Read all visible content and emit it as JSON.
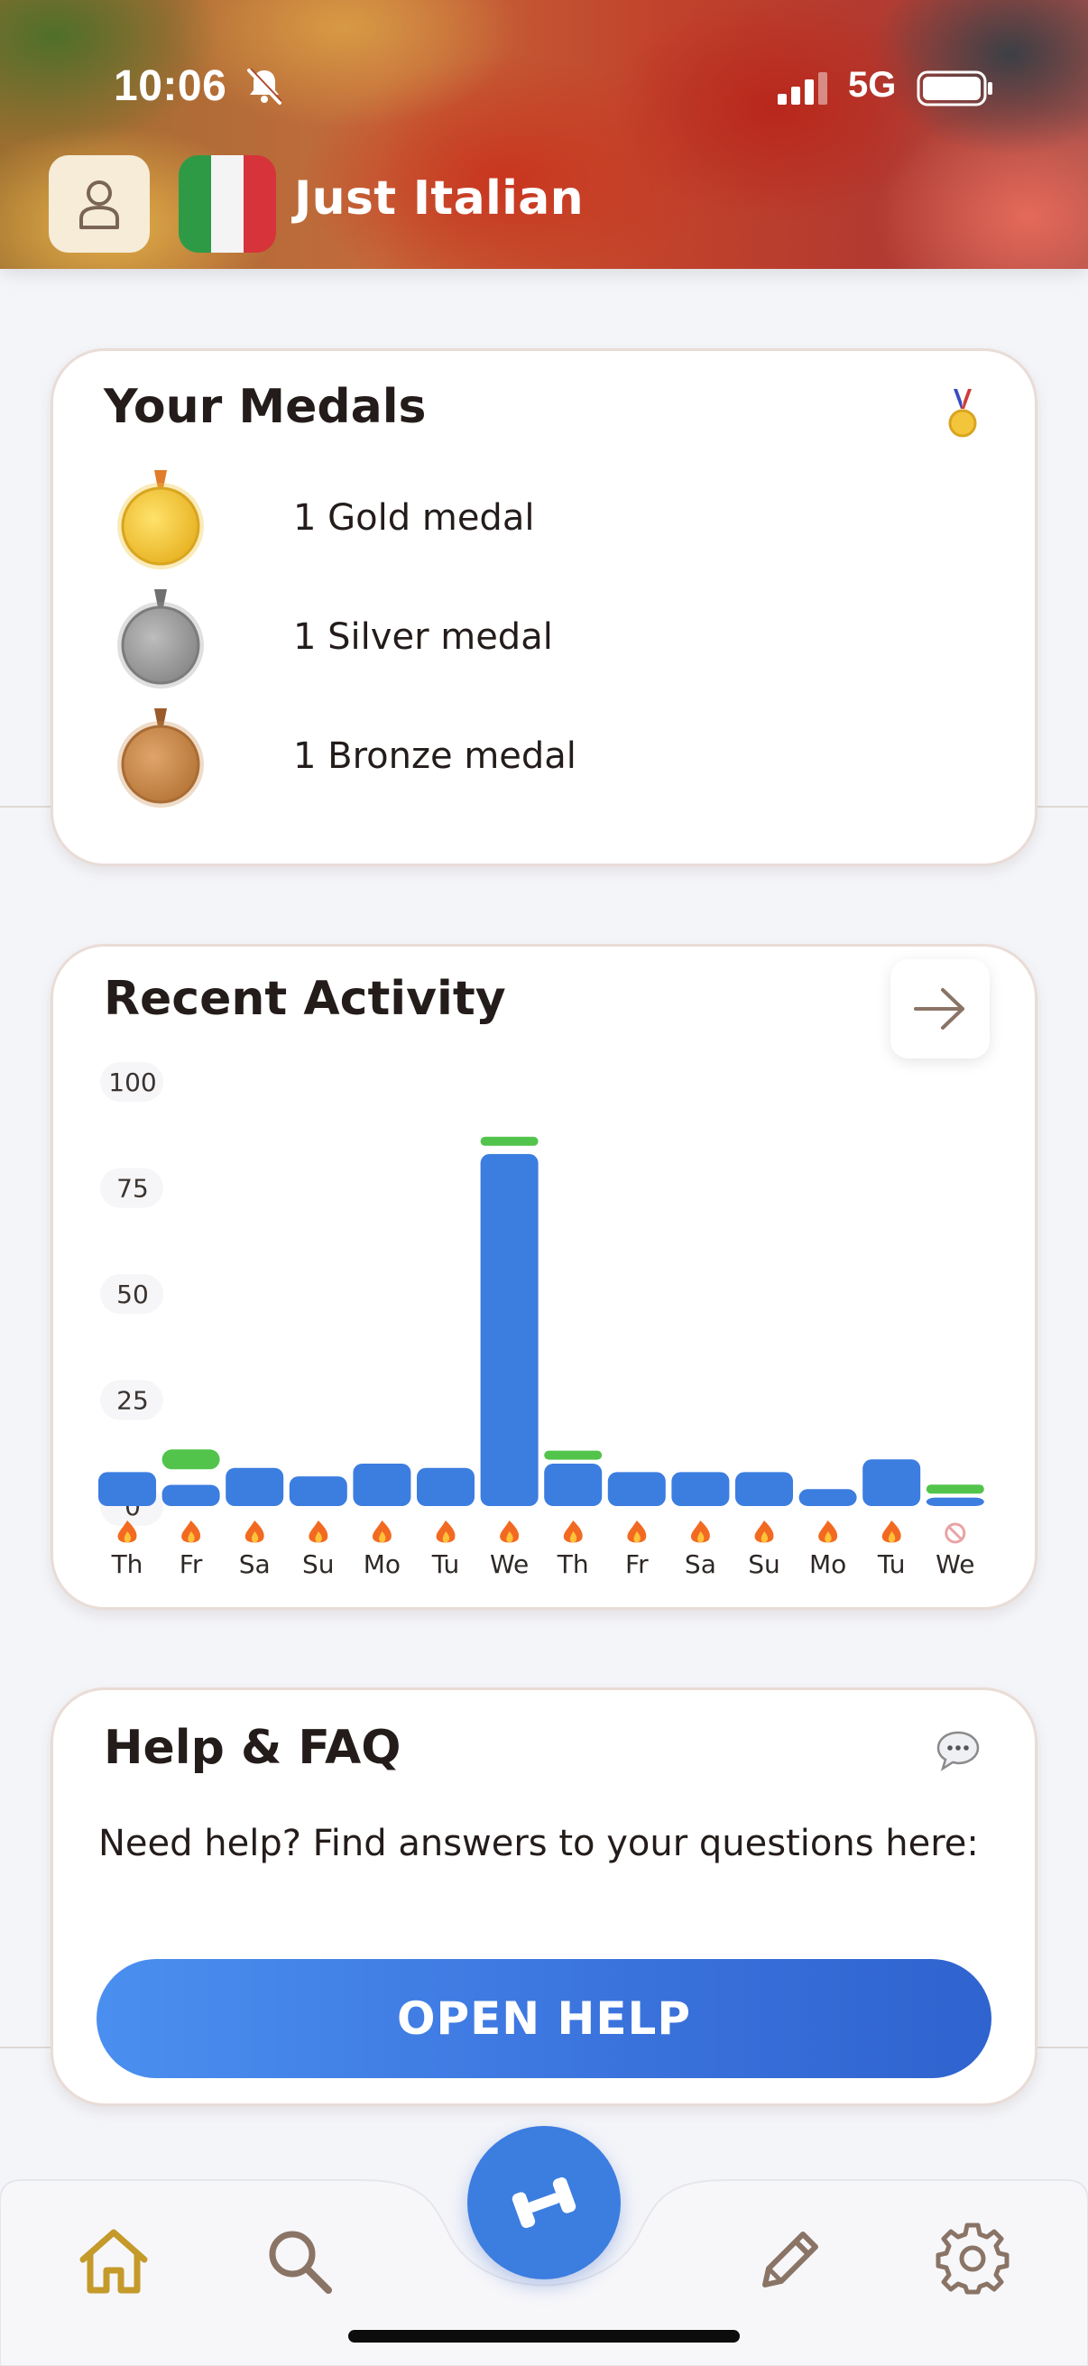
{
  "status_bar": {
    "time": "10:06",
    "network": "5G"
  },
  "header": {
    "title": "Just Italian",
    "flag_colors": [
      "#2e9a46",
      "#f4f4f4",
      "#d7333b"
    ]
  },
  "medals": {
    "title": "Your Medals",
    "items": [
      {
        "label": "1 Gold medal",
        "color": "#f2c53a"
      },
      {
        "label": "1 Silver medal",
        "color": "#9a9a9a"
      },
      {
        "label": "1 Bronze medal",
        "color": "#c8884a"
      }
    ]
  },
  "activity": {
    "title": "Recent Activity",
    "bar_color": "#3c7de0",
    "goal_color": "#52c44c"
  },
  "chart_data": {
    "type": "bar",
    "title": "Recent Activity",
    "ylim": [
      0,
      100
    ],
    "yticks": [
      "100",
      "75",
      "50",
      "25",
      "0"
    ],
    "categories": [
      "Th",
      "Fr",
      "Sa",
      "Su",
      "Mo",
      "Tu",
      "We",
      "Th",
      "Fr",
      "Sa",
      "Su",
      "Mo",
      "Tu",
      "We"
    ],
    "values": [
      8,
      5,
      9,
      7,
      10,
      9,
      83,
      10,
      8,
      8,
      8,
      4,
      11,
      2
    ],
    "goal_values": [
      null,
      11,
      null,
      null,
      null,
      null,
      86,
      12,
      null,
      null,
      null,
      null,
      null,
      4
    ],
    "streak_markers": [
      "fire",
      "fire",
      "fire",
      "fire",
      "fire",
      "fire",
      "fire",
      "fire",
      "fire",
      "fire",
      "fire",
      "fire",
      "fire",
      "none"
    ],
    "grid": false
  },
  "help": {
    "title": "Help & FAQ",
    "text": "Need help? Find answers to your questions here:",
    "button_label": "OPEN HELP"
  },
  "nav": {
    "items": [
      "home-icon",
      "search-icon",
      "dumbbell-icon",
      "pencil-icon",
      "gear-icon"
    ],
    "active_color": "#c49a2a",
    "inactive_color": "#8a7466"
  }
}
